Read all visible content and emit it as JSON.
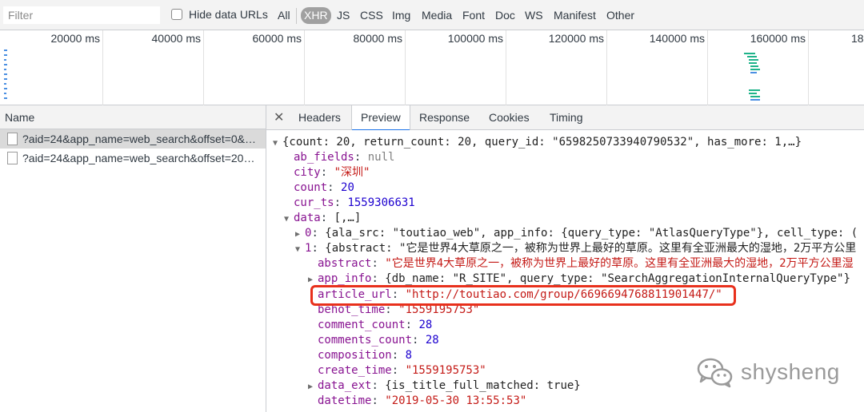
{
  "filter_bar": {
    "filter_placeholder": "Filter",
    "hide_data_urls_label": "Hide data URLs",
    "types": [
      "All",
      "XHR",
      "JS",
      "CSS",
      "Img",
      "Media",
      "Font",
      "Doc",
      "WS",
      "Manifest",
      "Other"
    ],
    "active_type": "XHR"
  },
  "timeline": {
    "ticks": [
      "20000 ms",
      "40000 ms",
      "60000 ms",
      "80000 ms",
      "100000 ms",
      "120000 ms",
      "140000 ms",
      "160000 ms",
      "18"
    ]
  },
  "request_list": {
    "header": "Name",
    "rows": [
      "?aid=24&app_name=web_search&offset=0&…",
      "?aid=24&app_name=web_search&offset=20…"
    ]
  },
  "tabs": {
    "close_icon": "close-icon",
    "items": [
      "Headers",
      "Preview",
      "Response",
      "Cookies",
      "Timing"
    ],
    "active": "Preview"
  },
  "preview": {
    "root_summary": "{count: 20, return_count: 20, query_id: \"6598250733940790532\", has_more: 1,…}",
    "ab_fields_key": "ab_fields",
    "ab_fields_val": "null",
    "city_key": "city",
    "city_val": "\"深圳\"",
    "count_key": "count",
    "count_val": "20",
    "cur_ts_key": "cur_ts",
    "cur_ts_val": "1559306631",
    "data_key": "data",
    "data_val": "[,…]",
    "item0_key": "0",
    "item0_val": "{ala_src: \"toutiao_web\", app_info: {query_type: \"AtlasQueryType\"}, cell_type: (",
    "item1_key": "1",
    "item1_val": "{abstract: \"它是世界4大草原之一，被称为世界上最好的草原。这里有全亚洲最大的湿地，2万平方公里",
    "abstract_key": "abstract",
    "abstract_val": "\"它是世界4大草原之一，被称为世界上最好的草原。这里有全亚洲最大的湿地，2万平方公里湿",
    "app_info_key": "app_info",
    "app_info_val": "{db_name: \"R_SITE\", query_type: \"SearchAggregationInternalQueryType\"}",
    "article_url_key": "article_url",
    "article_url_val": "\"http://toutiao.com/group/6696694768811901447/\"",
    "behot_time_key": "behot_time",
    "behot_time_val": "\"1559195753\"",
    "comment_count_key": "comment_count",
    "comment_count_val": "28",
    "comments_count_key": "comments_count",
    "comments_count_val": "28",
    "composition_key": "composition",
    "composition_val": "8",
    "create_time_key": "create_time",
    "create_time_val": "\"1559195753\"",
    "data_ext_key": "data_ext",
    "data_ext_val": "{is_title_full_matched: true}",
    "datetime_key": "datetime",
    "datetime_val": "\"2019-05-30 13:55:53\""
  },
  "watermark": {
    "text": "shysheng",
    "icon": "wechat-icon"
  },
  "colors": {
    "key": "#881391",
    "string": "#c41a16",
    "number": "#1c00cf",
    "highlight": "#e8301c",
    "tab_accent": "#1a73e8"
  }
}
